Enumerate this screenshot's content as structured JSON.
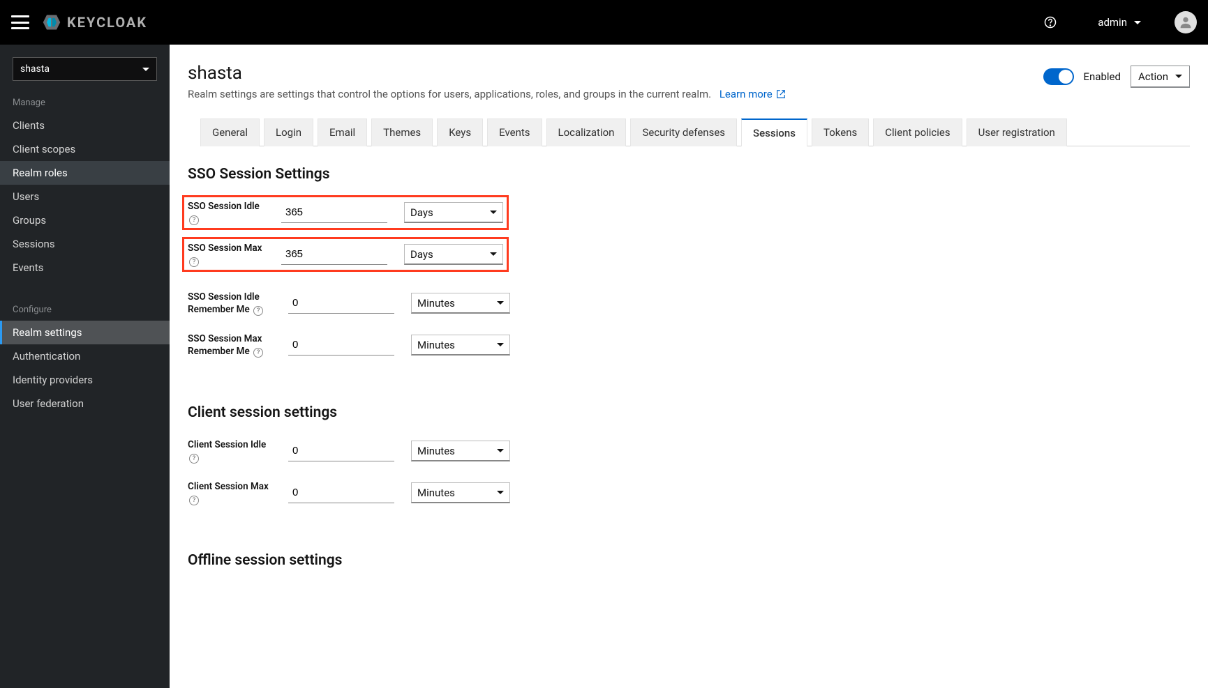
{
  "brand": "KEYCLOAK",
  "topbar": {
    "user_label": "admin"
  },
  "realm_selected": "shasta",
  "sidebar": {
    "manage_title": "Manage",
    "manage_items": [
      "Clients",
      "Client scopes",
      "Realm roles",
      "Users",
      "Groups",
      "Sessions",
      "Events"
    ],
    "configure_title": "Configure",
    "configure_items": [
      "Realm settings",
      "Authentication",
      "Identity providers",
      "User federation"
    ]
  },
  "page": {
    "title": "shasta",
    "description": "Realm settings are settings that control the options for users, applications, roles, and groups in the current realm.",
    "learn_more": "Learn more",
    "enabled_label": "Enabled",
    "action_label": "Action"
  },
  "tabs": [
    "General",
    "Login",
    "Email",
    "Themes",
    "Keys",
    "Events",
    "Localization",
    "Security defenses",
    "Sessions",
    "Tokens",
    "Client policies",
    "User registration"
  ],
  "active_tab": "Sessions",
  "sections": {
    "sso_title": "SSO Session Settings",
    "client_title": "Client session settings",
    "offline_title": "Offline session settings"
  },
  "fields": {
    "sso_idle": {
      "label": "SSO Session Idle",
      "value": "365",
      "unit": "Days",
      "highlight": true
    },
    "sso_max": {
      "label": "SSO Session Max",
      "value": "365",
      "unit": "Days",
      "highlight": true
    },
    "sso_idle_rm": {
      "label": "SSO Session Idle Remember Me",
      "value": "0",
      "unit": "Minutes",
      "highlight": false
    },
    "sso_max_rm": {
      "label": "SSO Session Max Remember Me",
      "value": "0",
      "unit": "Minutes",
      "highlight": false
    },
    "client_idle": {
      "label": "Client Session Idle",
      "value": "0",
      "unit": "Minutes",
      "highlight": false
    },
    "client_max": {
      "label": "Client Session Max",
      "value": "0",
      "unit": "Minutes",
      "highlight": false
    }
  }
}
